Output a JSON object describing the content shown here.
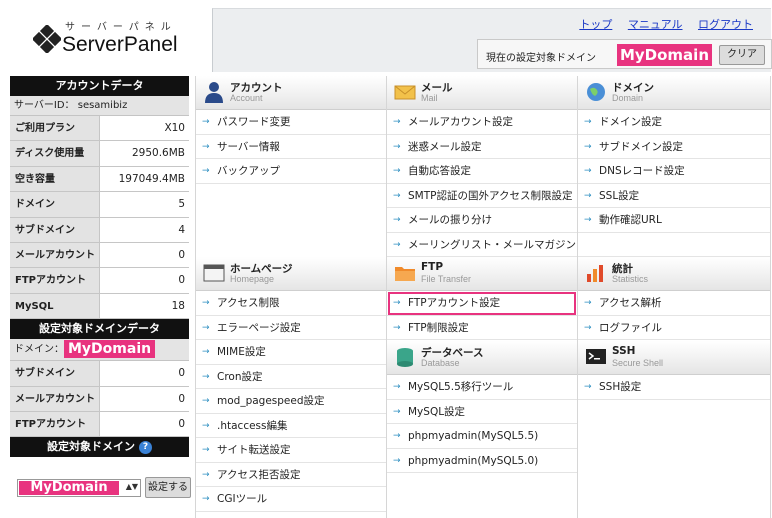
{
  "header": {
    "logo_kana": "サーバーパネル",
    "logo_text": "ServerPanel",
    "links": [
      "トップ",
      "マニュアル",
      "ログアウト"
    ],
    "current_domain_label": "現在の設定対象ドメイン",
    "current_domain_value": "MyDomain",
    "clear_label": "クリア"
  },
  "sidebar": {
    "account_title": "アカウントデータ",
    "server_id": "サーバーID： sesamibiz",
    "account_rows": [
      {
        "label": "ご利用プラン",
        "value": "X10"
      },
      {
        "label": "ディスク使用量",
        "value": "2950.6MB"
      },
      {
        "label": "空き容量",
        "value": "197049.4MB"
      },
      {
        "label": "ドメイン",
        "value": "5"
      },
      {
        "label": "サブドメイン",
        "value": "4"
      },
      {
        "label": "メールアカウント",
        "value": "0"
      },
      {
        "label": "FTPアカウント",
        "value": "0"
      },
      {
        "label": "MySQL",
        "value": "18"
      }
    ],
    "domain_data_title": "設定対象ドメインデータ",
    "domain_label": "ドメイン：",
    "domain_value": "MyDomain",
    "domain_rows": [
      {
        "label": "サブドメイン",
        "value": "0"
      },
      {
        "label": "メールアカウント",
        "value": "0"
      },
      {
        "label": "FTPアカウント",
        "value": "0"
      }
    ],
    "target_domain_title": "設定対象ドメイン",
    "help_icon": "?",
    "select_value": "MyDomain",
    "set_button": "設定する"
  },
  "menu": {
    "account": {
      "title": "アカウント",
      "sub": "Account",
      "icon": "person-icon",
      "items": [
        "パスワード変更",
        "サーバー情報",
        "バックアップ"
      ]
    },
    "mail": {
      "title": "メール",
      "sub": "Mail",
      "icon": "envelope-icon",
      "items": [
        "メールアカウント設定",
        "迷惑メール設定",
        "自動応答設定",
        "SMTP認証の国外アクセス制限設定",
        "メールの振り分け",
        "メーリングリスト・メールマガジン"
      ]
    },
    "domain": {
      "title": "ドメイン",
      "sub": "Domain",
      "icon": "globe-icon",
      "items": [
        "ドメイン設定",
        "サブドメイン設定",
        "DNSレコード設定",
        "SSL設定",
        "動作確認URL"
      ]
    },
    "homepage": {
      "title": "ホームページ",
      "sub": "Homepage",
      "icon": "window-icon",
      "items": [
        "アクセス制限",
        "エラーページ設定",
        "MIME設定",
        "Cron設定",
        "mod_pagespeed設定",
        ".htaccess編集",
        "サイト転送設定",
        "アクセス拒否設定",
        "CGIツール"
      ]
    },
    "ftp": {
      "title": "FTP",
      "sub": "File Transfer",
      "icon": "folder-icon",
      "items": [
        "FTPアカウント設定",
        "FTP制限設定"
      ]
    },
    "database": {
      "title": "データベース",
      "sub": "Database",
      "icon": "database-icon",
      "items": [
        "MySQL5.5移行ツール",
        "MySQL設定",
        "phpmyadmin(MySQL5.5)",
        "phpmyadmin(MySQL5.0)"
      ]
    },
    "stats": {
      "title": "統計",
      "sub": "Statistics",
      "icon": "bar-chart-icon",
      "items": [
        "アクセス解析",
        "ログファイル"
      ]
    },
    "ssh": {
      "title": "SSH",
      "sub": "Secure Shell",
      "icon": "terminal-icon",
      "items": [
        "SSH設定"
      ]
    }
  },
  "colors": {
    "accent_pink": "#e8337f",
    "link_blue": "#1a38c6",
    "sidebar_header": "#111111"
  }
}
